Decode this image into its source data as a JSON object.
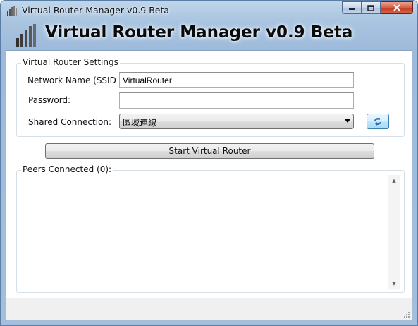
{
  "window": {
    "title": "Virtual Router Manager v0.9 Beta",
    "banner_title": "Virtual Router Manager v0.9 Beta",
    "controls": {
      "minimize_icon": "minimize-icon",
      "maximize_icon": "maximize-icon",
      "close_icon": "close-icon"
    }
  },
  "settings": {
    "group_label": "Virtual Router Settings",
    "network_name_label": "Network Name (SSID",
    "network_name_value": "VirtualRouter",
    "password_label": "Password:",
    "password_value": "",
    "shared_connection_label": "Shared Connection:",
    "shared_connection_value": "區域連線",
    "refresh_icon": "refresh-icon"
  },
  "actions": {
    "start_button": "Start Virtual Router"
  },
  "peers": {
    "label": "Peers Connected (0):"
  },
  "colors": {
    "title_bar": "#a9c4e0",
    "client_background": "#ffffff",
    "refresh_accent": "#3c7fb1"
  }
}
